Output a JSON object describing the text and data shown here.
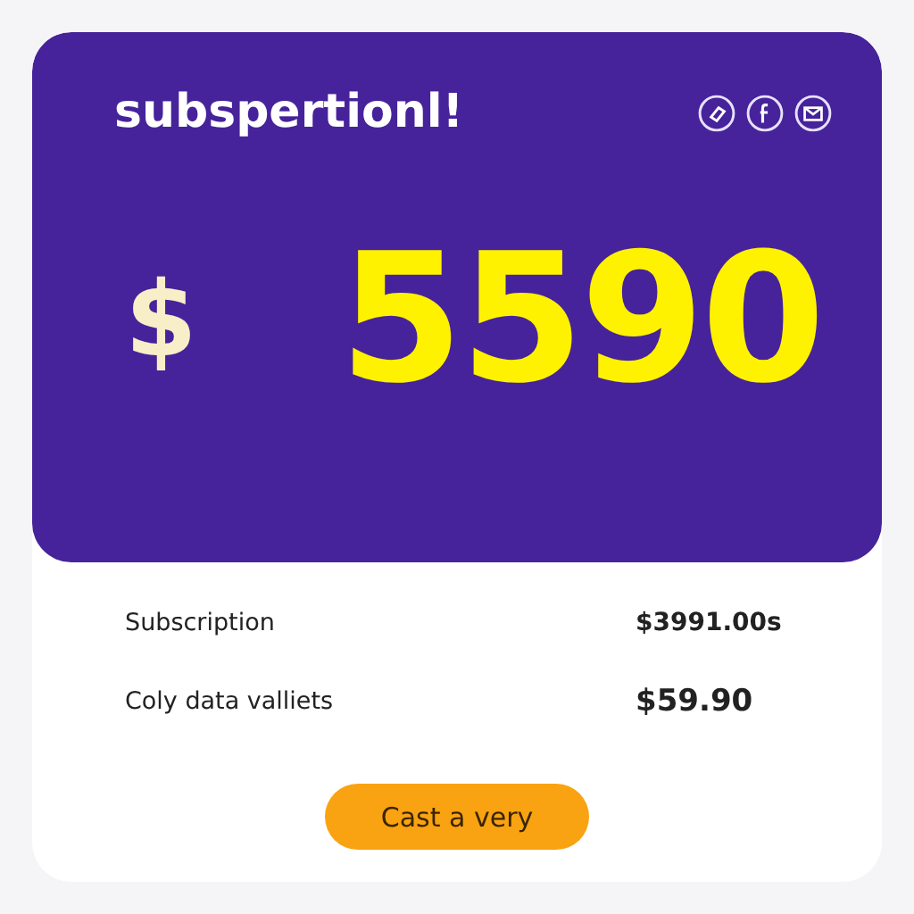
{
  "header": {
    "title": "subspertionl!",
    "currency": "$",
    "amount": "5590"
  },
  "rows": [
    {
      "label": "Subscription",
      "value": "$3991.00s",
      "kind": "normal"
    },
    {
      "label": "Coly data valliets",
      "value": "$59.90",
      "kind": "total"
    }
  ],
  "button": {
    "label": "Cast a very"
  }
}
